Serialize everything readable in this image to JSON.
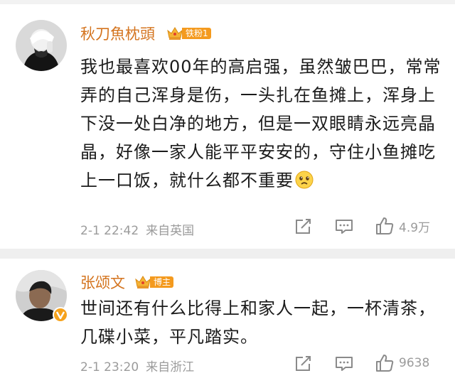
{
  "colors": {
    "username": "#d4741f",
    "badge_bg": "#f49a1e",
    "meta": "#9b9b9b",
    "divider": "#efefef"
  },
  "comments": [
    {
      "username": "秋刀魚枕頭",
      "badge": "铁粉1",
      "text": "我也最喜欢00年的高启强，虽然皱巴巴，常常弄的自己浑身是伤，一头扎在鱼摊上，浑身上下没一处白净的地方，但是一双眼睛永远亮晶晶，好像一家人能平平安安的，守住小鱼摊吃上一口饭，就什么都不重要",
      "emoji": "sad-face-emoji",
      "time": "2-1 22:42",
      "location": "来自英国",
      "likes": "4.9万",
      "icons": [
        "share-icon",
        "reply-icon",
        "like-icon"
      ]
    },
    {
      "username": "张颂文",
      "badge": "博主",
      "text": "世间还有什么比得上和家人一起，一杯清茶，几碟小菜，平凡踏实。",
      "time": "2-1 23:20",
      "location": "来自浙江",
      "likes": "9638",
      "icons": [
        "share-icon",
        "reply-icon",
        "like-icon",
        "verified-badge-icon"
      ]
    }
  ]
}
